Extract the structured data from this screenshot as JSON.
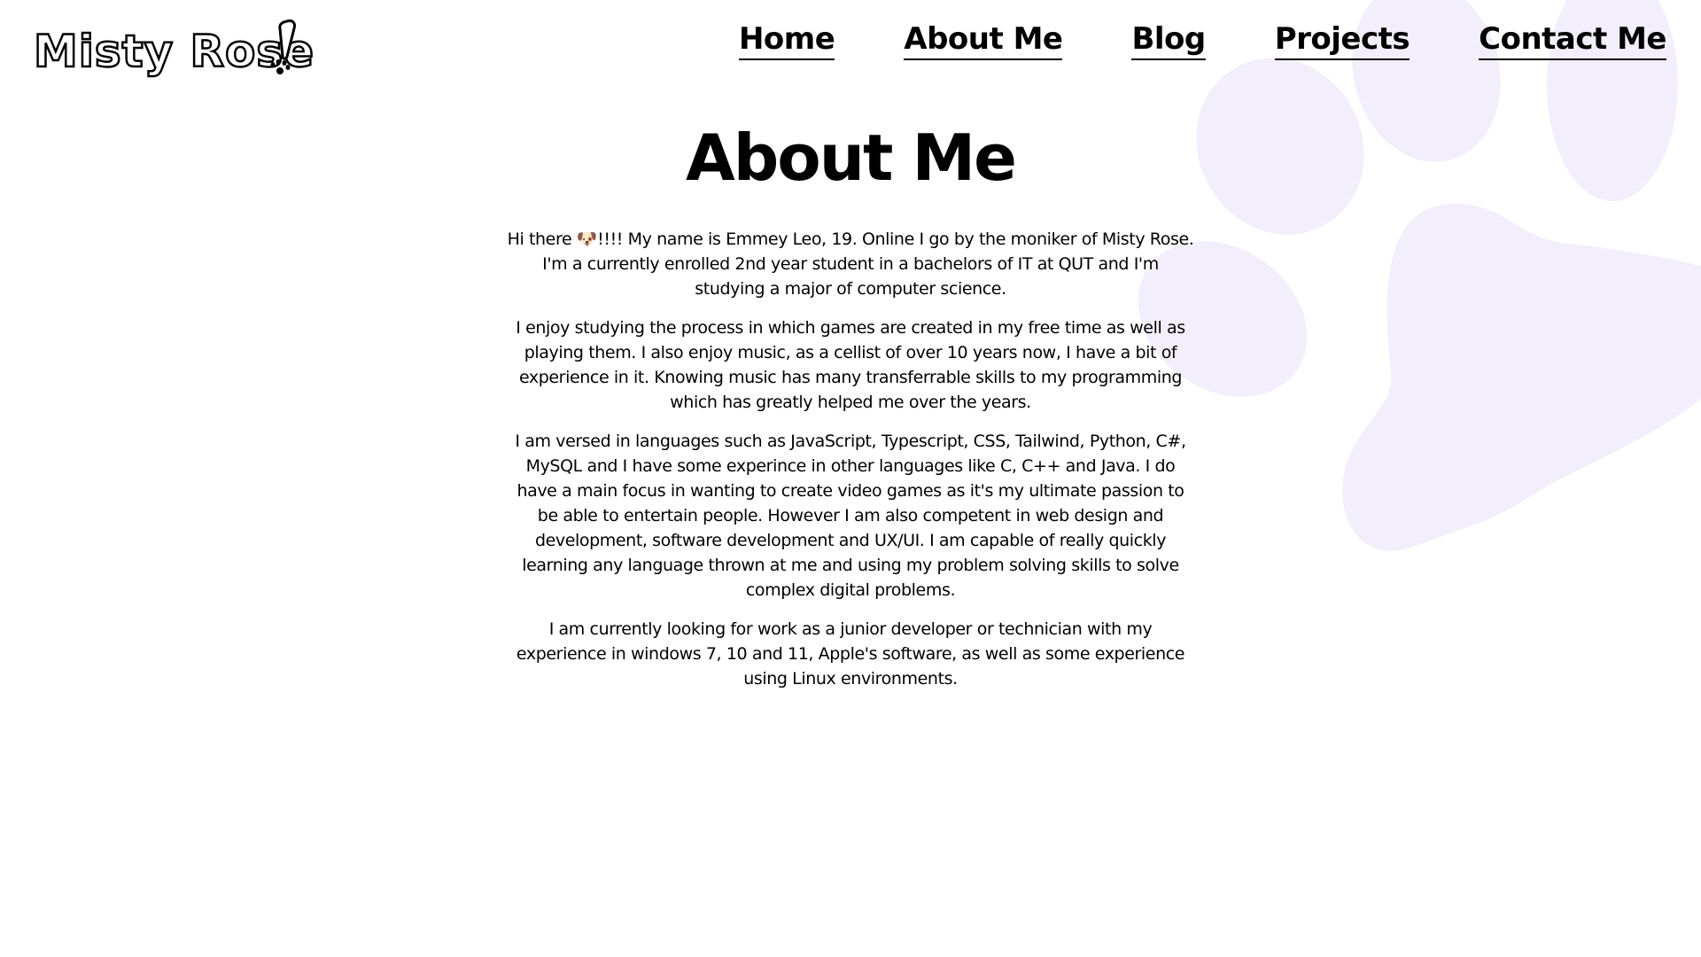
{
  "site": {
    "logo_text": "Misty Rose",
    "logo_mark": "exclamation-paw-icon"
  },
  "nav": {
    "items": [
      {
        "label": "Home"
      },
      {
        "label": "About Me"
      },
      {
        "label": "Blog"
      },
      {
        "label": "Projects"
      },
      {
        "label": "Contact Me"
      }
    ]
  },
  "main": {
    "title": "About Me",
    "paragraphs": [
      {
        "before": "Hi there ",
        "emoji": "🐶",
        "after": "!!!! My name is Emmey Leo, 19. Online I go by the moniker of Misty Rose. I'm a currently enrolled 2nd year student in a bachelors of IT at QUT and I'm studying a major of computer science."
      },
      {
        "text": "I enjoy studying the process in which games are created in my free time as well as playing them. I also enjoy music, as a cellist of over 10 years now, I have a bit of experience in it. Knowing music has many transferrable skills to my programming which has greatly helped me over the years."
      },
      {
        "text": "I am versed in languages such as JavaScript, Typescript, CSS, Tailwind, Python, C#, MySQL and I have some experince in other languages like C, C++ and Java. I do have a main focus in wanting to create video games as it's my ultimate passion to be able to entertain people. However I am also competent in web design and development, software development and UX/UI. I am capable of really quickly learning any language thrown at me and using my problem solving skills to solve complex digital problems."
      },
      {
        "text": "I am currently looking for work as a junior developer or technician with my experience in windows 7, 10 and 11, Apple's software, as well as some experience using Linux environments."
      }
    ]
  },
  "colors": {
    "background": "#ffffff",
    "paw": "#f3eefb",
    "text": "#000000"
  },
  "decor": {
    "background_icon": "paw-print-icon"
  }
}
